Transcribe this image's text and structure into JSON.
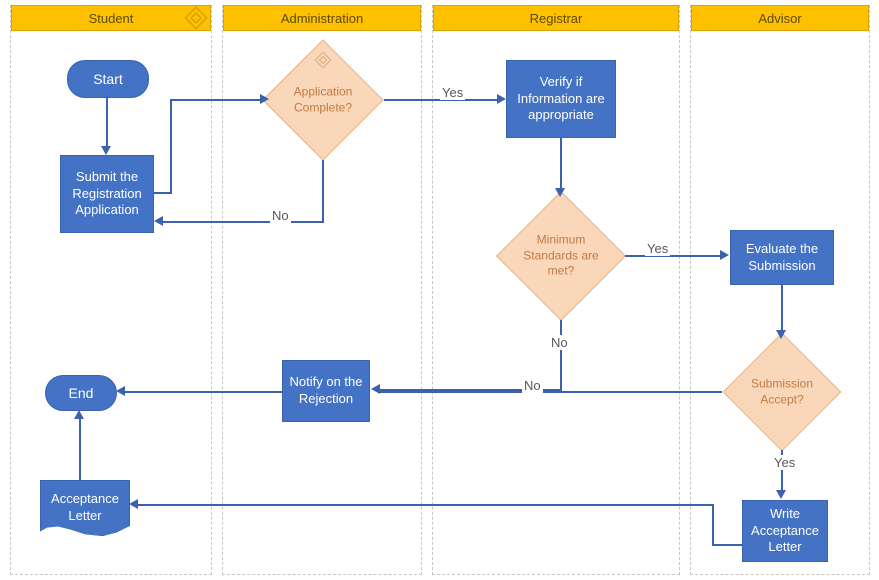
{
  "lanes": {
    "student": "Student",
    "administration": "Administration",
    "registrar": "Registrar",
    "advisor": "Advisor"
  },
  "nodes": {
    "start": "Start",
    "end": "End",
    "submit": "Submit the Registration Application",
    "appComplete": "Application Complete?",
    "verify": "Verify if Information are appropriate",
    "minStd": "Minimum Standards are met?",
    "notify": "Notify on the Rejection",
    "evaluate": "Evaluate the Submission",
    "subAccept": "Submission Accept?",
    "writeAccept": "Write Acceptance Letter",
    "acceptLetter": "Acceptance Letter"
  },
  "edges": {
    "yes": "Yes",
    "no": "No"
  }
}
